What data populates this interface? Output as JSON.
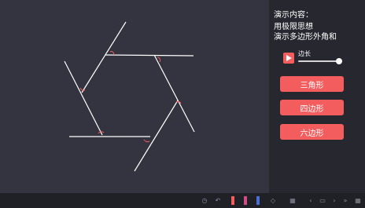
{
  "panel": {
    "heading": "演示内容：",
    "line1": "用极限思想",
    "line2": "演示多边形外角和",
    "slider_label": "边长",
    "slider_value": 0.95,
    "buttons": [
      "三角形",
      "四边形",
      "六边形"
    ]
  },
  "colors": {
    "accent": "#f35d5d",
    "canvas_bg": "#33343f",
    "panel_bg": "#26272f",
    "toolbar_bg": "#202127"
  },
  "toolbar": {
    "items": [
      "alarm-icon",
      "undo-icon",
      "pen-red-icon",
      "pen-pink-icon",
      "pen-blue-icon",
      "eraser-icon",
      "prev-icon",
      "page-icon",
      "next-icon",
      "expand-icon",
      "grid-icon"
    ]
  }
}
